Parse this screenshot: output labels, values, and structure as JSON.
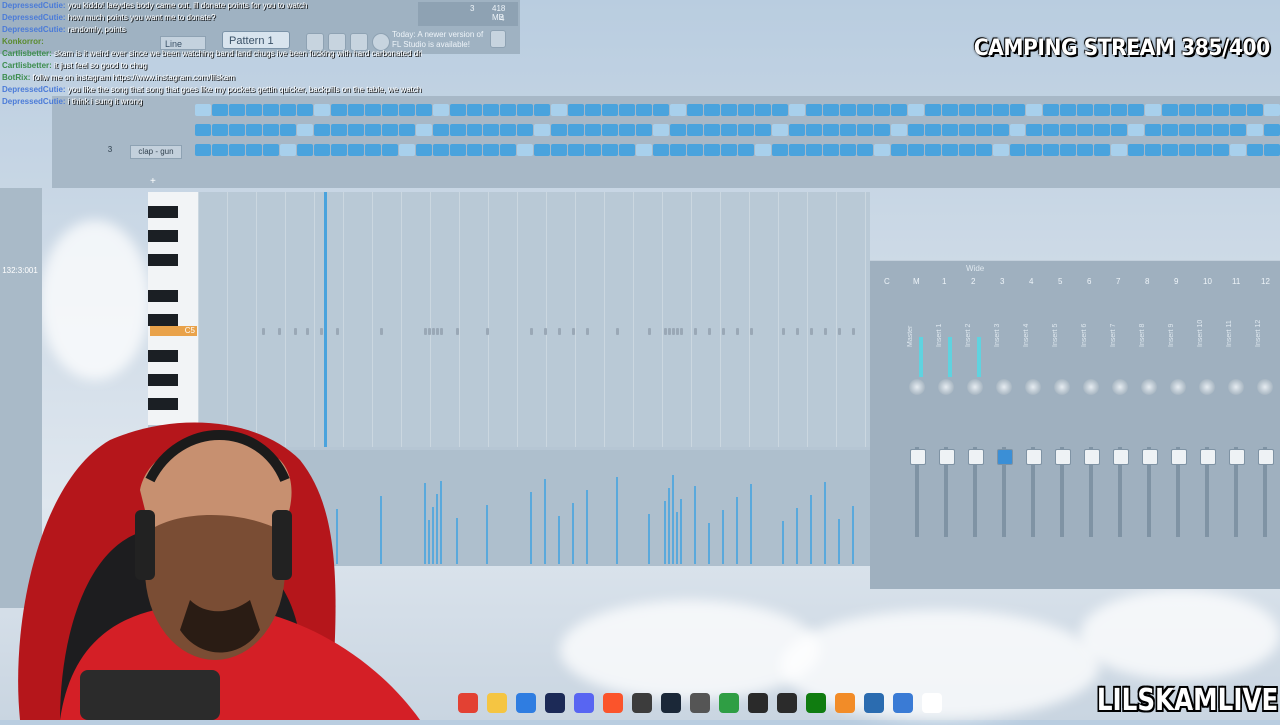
{
  "overlay": {
    "stream_title": "CAMPING STREAM 385/400",
    "channel_name": "LILSKAMLIVE"
  },
  "daw": {
    "memory_readout": "418 MB",
    "cpu_readout": "3",
    "polyphony": "4",
    "snap_value": "Line",
    "pattern_name": "Pattern 1",
    "news_panel": "Today: A newer version of FL Studio is available!",
    "channel_rack": {
      "channel_label": "clap - gun",
      "channel_number": "3"
    },
    "piano_roll": {
      "key_label": "C5",
      "position_readout": "132:3:001"
    },
    "mixer": {
      "tracks": [
        "C",
        "M",
        "1",
        "2",
        "3",
        "4",
        "5",
        "6",
        "7",
        "8",
        "9",
        "10",
        "11",
        "12"
      ],
      "insert_names": [
        "Master",
        "Insert 1",
        "Insert 2",
        "Insert 3",
        "Insert 4",
        "Insert 5",
        "Insert 6",
        "Insert 7",
        "Insert 8",
        "Insert 9",
        "Insert 10",
        "Insert 11",
        "Insert 12"
      ],
      "mode_label": "Wide"
    }
  },
  "chat": [
    {
      "user": "DepressedCutie",
      "color": "#4b7bd8",
      "text": "you kiddo! laeydes body came out, ill donate points for you to watch"
    },
    {
      "user": "DepressedCutie",
      "color": "#4b7bd8",
      "text": "how much points you want me to donate?"
    },
    {
      "user": "DepressedCutie",
      "color": "#4b7bd8",
      "text": "randomly, points"
    },
    {
      "user": "Konkorror",
      "color": "#5a8b2e",
      "text": ""
    },
    {
      "user": "Cartlisbetter",
      "color": "#3c8d4d",
      "text": "skam is it weird ever since we been watching band land chugs ive been fucking with hard carbonated drinks lately"
    },
    {
      "user": "Cartlisbetter",
      "color": "#3c8d4d",
      "text": "it just feel so good to chug"
    },
    {
      "user": "BotRix",
      "color": "#3c8d4d",
      "text": "follw me on instagram https://www.instagram.com/lilskam"
    },
    {
      "user": "DepressedCutie",
      "color": "#4b7bd8",
      "text": "you like the song that song that goes like my pockets gettin quicker, backpills on the table, we watchin cable"
    },
    {
      "user": "DepressedCutie",
      "color": "#4b7bd8",
      "text": "i think i sung it wrong"
    }
  ],
  "taskbar": {
    "icons": [
      "chrome-icon",
      "folder-icon",
      "store-icon",
      "photoshop-icon",
      "discord-icon",
      "brave-icon",
      "obs-icon",
      "steam-icon",
      "app-icon",
      "winamp-icon",
      "4k-icon",
      "capcut-icon",
      "xbox-icon",
      "fl-studio-icon",
      "calculator-icon",
      "photos-icon",
      "notepad-icon"
    ]
  }
}
